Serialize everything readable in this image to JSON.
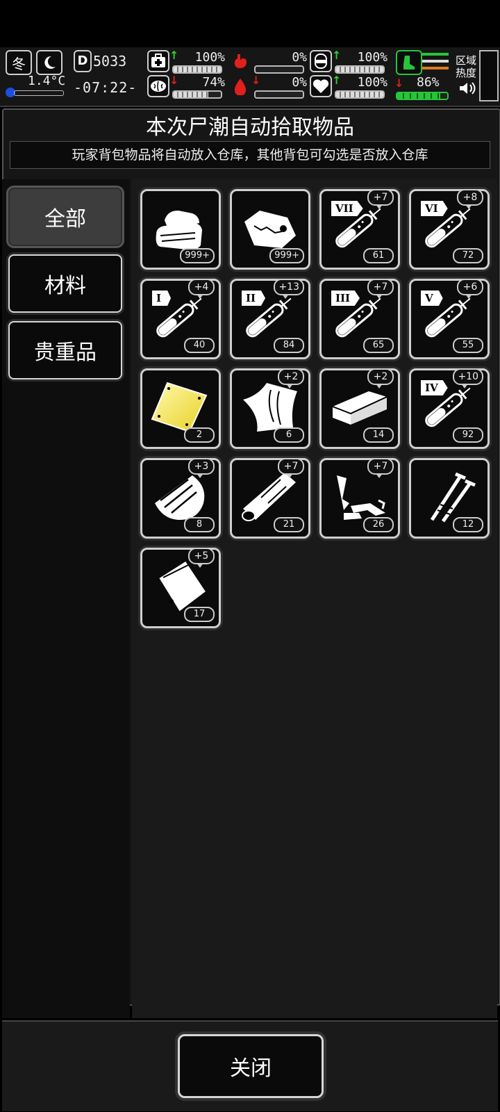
{
  "hud": {
    "season_label": "冬",
    "temperature": "1.4°C",
    "day_label": "D",
    "day_number": "5033",
    "clock": "-07:22-",
    "stats": [
      {
        "icon": "medkit-icon",
        "value": "100%",
        "trend": "up",
        "level": 1.0
      },
      {
        "icon": "stomach-icon",
        "value": "0%",
        "trend": "none",
        "level": 0.0
      },
      {
        "icon": "bandage-icon",
        "value": "100%",
        "trend": "up",
        "level": 1.0
      },
      {
        "icon": "brain-icon",
        "value": "74%",
        "trend": "down",
        "level": 0.74
      },
      {
        "icon": "blood-drop-icon",
        "value": "0%",
        "trend": "down",
        "level": 0.0
      },
      {
        "icon": "heart-icon",
        "value": "100%",
        "trend": "up",
        "level": 1.0
      }
    ],
    "stamina_value": "86%",
    "stamina_level": 0.86,
    "region_heat_label": "区域\n热度",
    "colors": {
      "up": "#2fd02f",
      "down": "#e0201c",
      "stamina": "#27c53a",
      "orange": "#e07a18"
    }
  },
  "dialog": {
    "title": "本次尸潮自动拾取物品",
    "subtitle": "玩家背包物品将自动放入仓库，其他背包可勾选是否放入仓库",
    "tabs": [
      {
        "label": "全部",
        "active": true
      },
      {
        "label": "材料",
        "active": false
      },
      {
        "label": "贵重品",
        "active": false
      }
    ],
    "items": [
      {
        "name": "cloth-icon",
        "count": "999+",
        "bonus": "",
        "numeral": ""
      },
      {
        "name": "meat-icon",
        "count": "999+",
        "bonus": "",
        "numeral": ""
      },
      {
        "name": "syringe-icon",
        "count": "61",
        "bonus": "+7",
        "numeral": "VII"
      },
      {
        "name": "syringe-icon",
        "count": "72",
        "bonus": "+8",
        "numeral": "VI"
      },
      {
        "name": "syringe-icon",
        "count": "40",
        "bonus": "+4",
        "numeral": "I"
      },
      {
        "name": "syringe-icon",
        "count": "84",
        "bonus": "+13",
        "numeral": "II"
      },
      {
        "name": "syringe-icon",
        "count": "65",
        "bonus": "+7",
        "numeral": "III"
      },
      {
        "name": "syringe-icon",
        "count": "55",
        "bonus": "+6",
        "numeral": "V"
      },
      {
        "name": "gold-plate-icon",
        "count": "2",
        "bonus": "",
        "numeral": ""
      },
      {
        "name": "cloth-sheet-icon",
        "count": "6",
        "bonus": "+2",
        "numeral": ""
      },
      {
        "name": "brick-icon",
        "count": "14",
        "bonus": "+2",
        "numeral": ""
      },
      {
        "name": "syringe-icon",
        "count": "92",
        "bonus": "+10",
        "numeral": "IV"
      },
      {
        "name": "bark-icon",
        "count": "8",
        "bonus": "+3",
        "numeral": ""
      },
      {
        "name": "log-icon",
        "count": "21",
        "bonus": "+7",
        "numeral": ""
      },
      {
        "name": "scrap-metal-icon",
        "count": "26",
        "bonus": "+7",
        "numeral": ""
      },
      {
        "name": "nails-icon",
        "count": "12",
        "bonus": "",
        "numeral": ""
      },
      {
        "name": "plastic-bag-icon",
        "count": "17",
        "bonus": "+5",
        "numeral": ""
      }
    ],
    "close_label": "关闭"
  }
}
